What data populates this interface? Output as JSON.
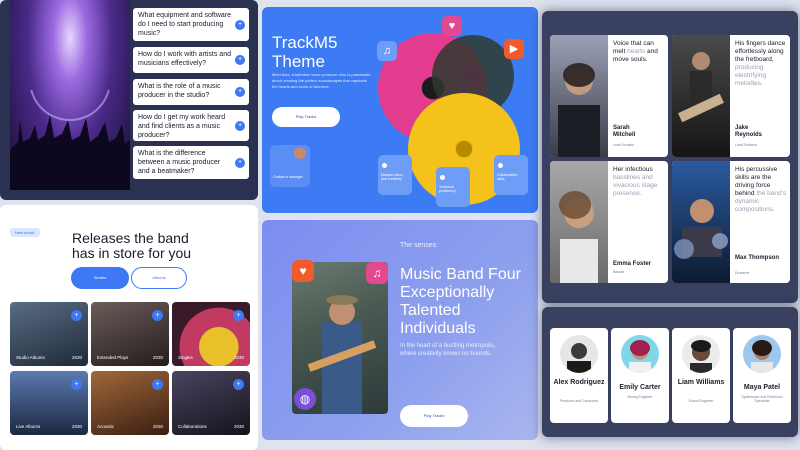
{
  "faq": {
    "questions": [
      "What equipment and software do I need to start producing music?",
      "How do I work with artists and musicians effectively?",
      "What is the role of a music producer in the studio?",
      "How do I get my work heard and find clients as a music producer?",
      "What is the difference between a music producer and a beatmaker?"
    ],
    "toggle_icon": "+"
  },
  "theme": {
    "title_line1": "TrackM5",
    "title_line2": "Theme",
    "description": "Meet Alex, a talented music producer who is passionate about creating the perfect soundscapes that captivate the hearts and souls of listeners.",
    "cta": "Play Tracks",
    "contact_chip": "Contact a manager",
    "chips": [
      "Musical vision and creativity",
      "Technical proficiency",
      "Collaboration skills"
    ],
    "icons": [
      "heart-icon",
      "music-note-icon",
      "play-icon"
    ]
  },
  "releases": {
    "badge": "New music",
    "heading_line1": "Releases the band",
    "heading_line2": "has in store for you",
    "btn_primary": "Stories",
    "btn_secondary": "Albums",
    "cards": [
      {
        "label": "Studio Albums",
        "year": "2030"
      },
      {
        "label": "Extended Plays",
        "year": "2030"
      },
      {
        "label": "Singles",
        "year": "2030"
      },
      {
        "label": "Live Albums",
        "year": "2030"
      },
      {
        "label": "Acoustic",
        "year": "2030"
      },
      {
        "label": "Collaborations",
        "year": "2030"
      }
    ]
  },
  "senses": {
    "eyebrow": "The senses",
    "heading": "Music Band Four Exceptionally Talented Individuals",
    "body": "In the heart of a bustling metropolis, where creativity knows no bounds.",
    "cta": "Play Tracks"
  },
  "team": [
    {
      "quote_bold": "Voice that can melt",
      "quote_muted": "hearts",
      "quote_rest": "and move souls.",
      "name": "Sarah Mitchell",
      "role": "Lead Vocalist"
    },
    {
      "quote_bold": "His fingers dance effortlessly along the fretboard,",
      "quote_muted": "producing electrifying melodies.",
      "quote_rest": "",
      "name": "Jake Reynolds",
      "role": "Lead Guitarist"
    },
    {
      "quote_bold": "Her infectious",
      "quote_muted": "basslines and vivacious stage presence.",
      "quote_rest": "",
      "name": "Emma Foster",
      "role": "Bassist"
    },
    {
      "quote_bold": "His percussive skills are the driving force behind",
      "quote_muted": "the band's dynamic compositions.",
      "quote_rest": "",
      "name": "Max Thompson",
      "role": "Drummer"
    }
  ],
  "members": [
    {
      "name": "Alex Rodriguez",
      "role": "Producer and Composer"
    },
    {
      "name": "Emily Carter",
      "role": "Mixing Engineer"
    },
    {
      "name": "Liam Williams",
      "role": "Sound Engineer"
    },
    {
      "name": "Maya Patel",
      "role": "Synthesizer and Electronic Specialist"
    }
  ]
}
